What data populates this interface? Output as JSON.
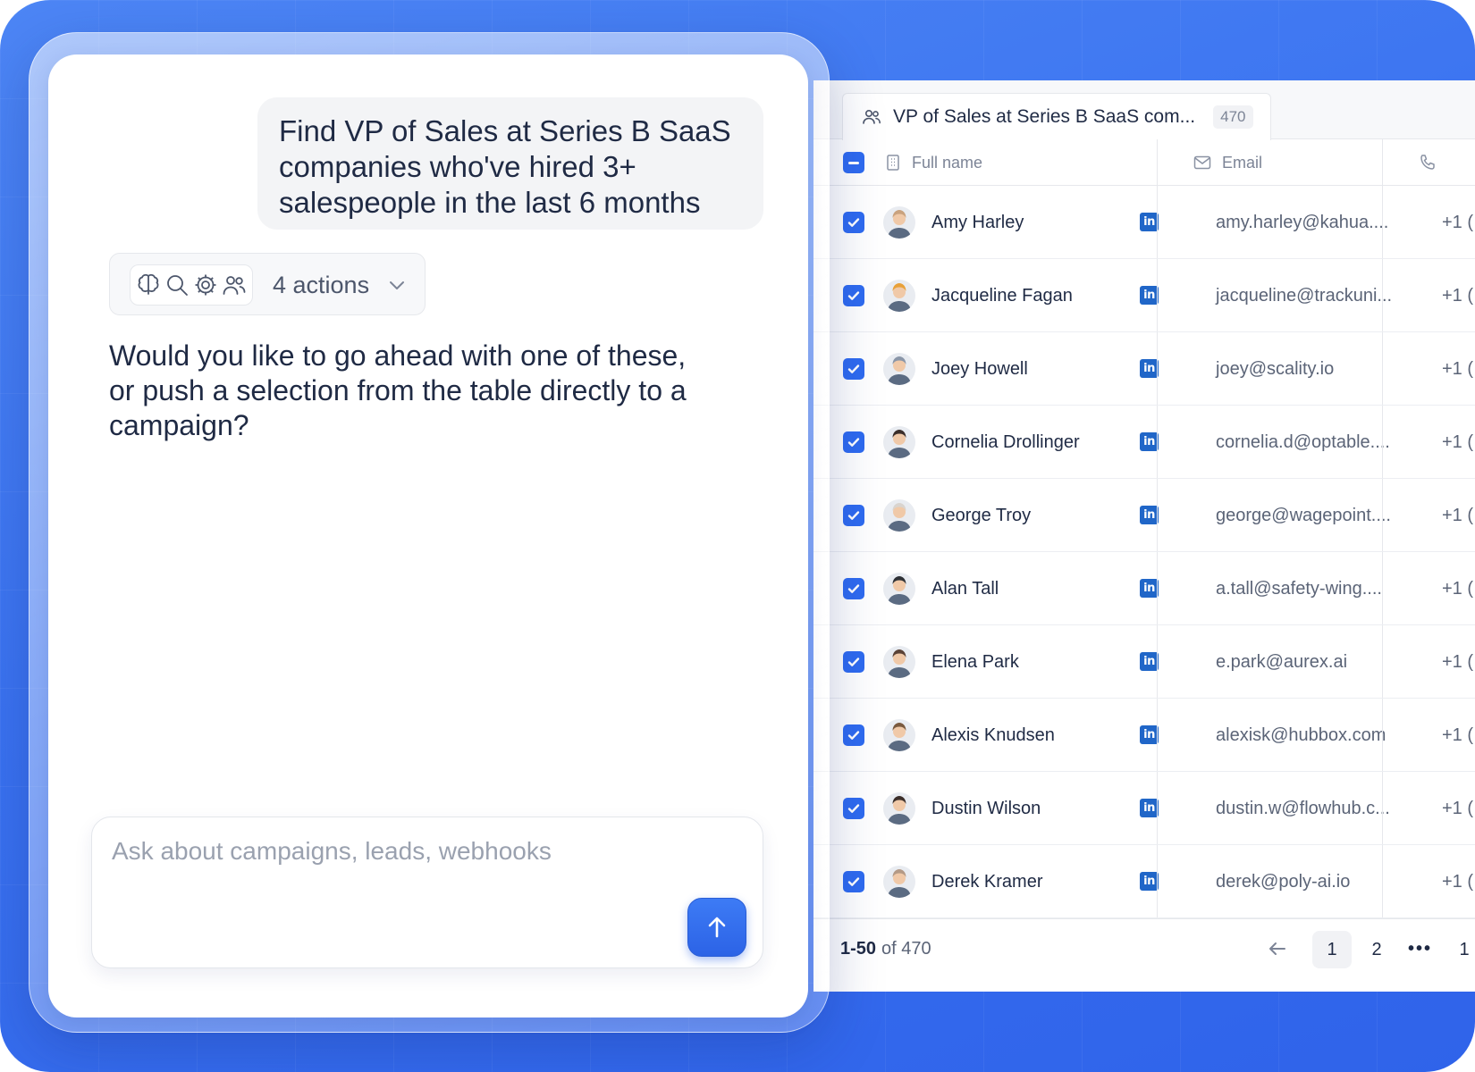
{
  "chat": {
    "user_message": "Find VP of Sales at Series B SaaS companies who've hired 3+ salespeople in the last 6 months",
    "actions_label": "4 actions",
    "action_icons": [
      "brain-icon",
      "search-icon",
      "gear-icon",
      "users-icon"
    ],
    "assistant_message": "Would you like to go ahead with one of these, or push a selection from the table directly to a campaign?",
    "composer_placeholder": "Ask about campaigns, leads, webhooks"
  },
  "table": {
    "tab_title": "VP of Sales at Series B SaaS com...",
    "tab_count": "470",
    "columns": {
      "name": "Full name",
      "email": "Email"
    },
    "rows": [
      {
        "name": "Amy Harley",
        "email": "amy.harley@kahua....",
        "phone": "+1 (",
        "avatar_color": "#c9a27e"
      },
      {
        "name": "Jacqueline Fagan",
        "email": "jacqueline@trackuni...",
        "phone": "+1 (",
        "avatar_color": "#e8a13a"
      },
      {
        "name": "Joey Howell",
        "email": "joey@scality.io",
        "phone": "+1 (",
        "avatar_color": "#8a96a8"
      },
      {
        "name": "Cornelia Drollinger",
        "email": "cornelia.d@optable....",
        "phone": "+1 (",
        "avatar_color": "#3b2e2a"
      },
      {
        "name": "George Troy",
        "email": "george@wagepoint....",
        "phone": "+1 (",
        "avatar_color": "#d9d4cf"
      },
      {
        "name": "Alan Tall",
        "email": "a.tall@safety-wing....",
        "phone": "+1 (",
        "avatar_color": "#2e3136"
      },
      {
        "name": "Elena Park",
        "email": "e.park@aurex.ai",
        "phone": "+1 (",
        "avatar_color": "#5a4236"
      },
      {
        "name": "Alexis Knudsen",
        "email": "alexisk@hubbox.com",
        "phone": "+1 (",
        "avatar_color": "#7a5a3f"
      },
      {
        "name": "Dustin Wilson",
        "email": "dustin.w@flowhub.c...",
        "phone": "+1 (",
        "avatar_color": "#3c2f2a"
      },
      {
        "name": "Derek Kramer",
        "email": "derek@poly-ai.io",
        "phone": "+1 (",
        "avatar_color": "#b49a86"
      }
    ],
    "linkedin_label": "in",
    "pagination": {
      "range": "1-50",
      "of_text": "of 470",
      "pages": [
        "1",
        "2"
      ],
      "active_page": "1",
      "more": "•••",
      "last_partial": "1"
    }
  },
  "colors": {
    "accent": "#2f6bf0",
    "background": "#3a72f0",
    "linkedin": "#2066c8"
  }
}
